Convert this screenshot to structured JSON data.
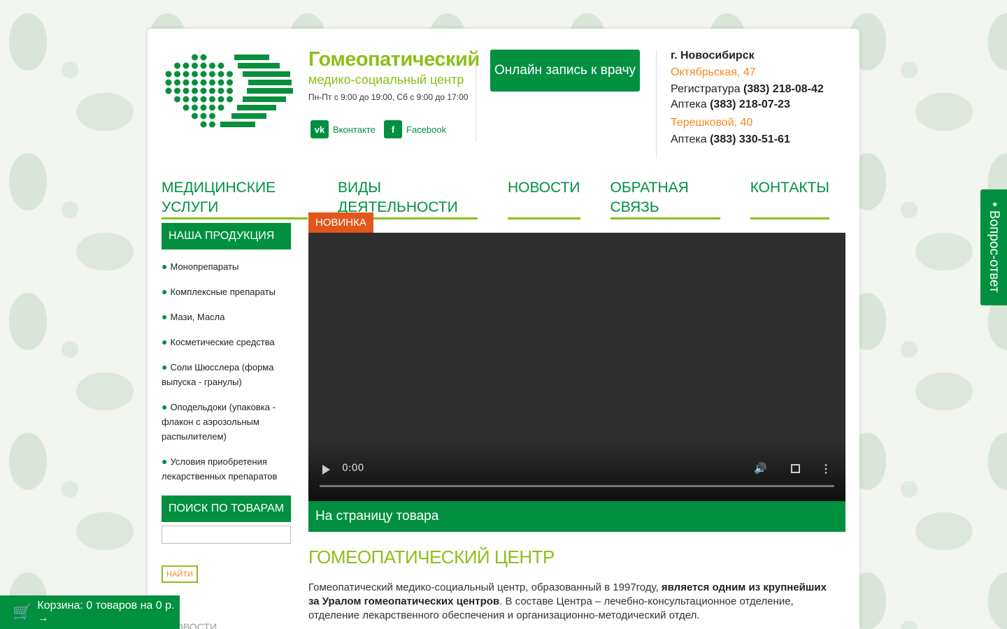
{
  "brand": {
    "title": "Гомеопатический",
    "subtitle": "медико-социальный центр",
    "hours": "Пн-Пт с 9:00 до 19:00, Сб с 9:00 до 17:00"
  },
  "social": {
    "vk_label": "Вконтакте",
    "vk_icon": "vk-icon",
    "fb_label": "Facebook",
    "fb_icon": "facebook-icon"
  },
  "cta": {
    "label": "Онлайн запись к врачу"
  },
  "contacts": {
    "city": "г. Новосибирск",
    "address1": "Октябрьская, 47",
    "reg_label": "Регистратура",
    "reg_phone": "(383) 218-08-42",
    "pharm1_label": "Аптека",
    "pharm1_phone": "(383) 218-07-23",
    "address2": "Терешковой, 40",
    "pharm2_label": "Аптека",
    "pharm2_phone": "(383) 330-51-61"
  },
  "nav": {
    "items": [
      {
        "label": "МЕДИЦИНСКИЕ УСЛУГИ"
      },
      {
        "label": "ВИДЫ ДЕЯТЕЛЬНОСТИ"
      },
      {
        "label": "НОВОСТИ"
      },
      {
        "label": "ОБРАТНАЯ СВЯЗЬ"
      },
      {
        "label": "КОНТАКТЫ"
      }
    ]
  },
  "sidebar": {
    "products_heading": "НАША ПРОДУКЦИЯ",
    "products": [
      {
        "label": "Монопрепараты"
      },
      {
        "label": "Комплексные препараты"
      },
      {
        "label": "Мази, Масла"
      },
      {
        "label": "Косметические средства"
      },
      {
        "label": "Соли Шюсслера (форма выпуска - гранулы)"
      },
      {
        "label": "Оподельдоки (упаковка - флакон с аэрозольным распылителем)"
      },
      {
        "label": "Условия приобретения лекарственных препаратов"
      }
    ],
    "search_heading": "ПОИСК ПО ТОВАРАМ",
    "search_placeholder": "",
    "search_button": "НАЙТИ",
    "news_heading": "НОВОСТИ"
  },
  "main": {
    "badge": "НОВИНКА",
    "video_time": "0:00",
    "to_product": "На страницу товара",
    "title": "ГОМЕОПАТИЧЕСКИЙ ЦЕНТР",
    "text_part1": "Гомеопатический медико-социальный центр, образованный в 1997году, ",
    "text_bold": "является одним из крупнейших за Уралом гомеопатических центров",
    "text_part2": ". В составе Центра – лечебно-консультационное отделение, отделение лекарственного обеспечения и организационно-методический отдел."
  },
  "cart": {
    "label": "Корзина: 0 товаров на 0 р. →",
    "icon": "cart-icon"
  },
  "faq": {
    "label": "• Вопрос-ответ"
  },
  "colors": {
    "green": "#009040",
    "lime": "#8cbf1a",
    "orange": "#f08a1e",
    "badge": "#e2561a"
  }
}
